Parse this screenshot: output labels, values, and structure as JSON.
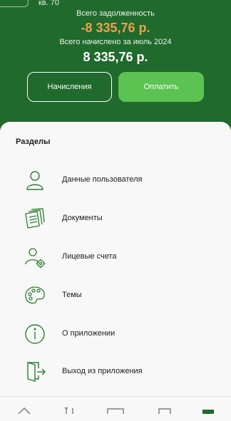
{
  "header": {
    "apartment": "кв. 70",
    "debt_label": "Всего задолженность",
    "debt_value": "-8 335,76 р.",
    "charged_label": "Всего начислено за июль 2024",
    "charged_value": "8 335,76 р."
  },
  "buttons": {
    "charges": "Начисления",
    "pay": "Оплатить"
  },
  "sections": {
    "title": "Разделы",
    "items": [
      {
        "label": "Данные пользователя",
        "icon": "user-icon"
      },
      {
        "label": "Документы",
        "icon": "documents-icon"
      },
      {
        "label": "Лицевые счета",
        "icon": "accounts-icon"
      },
      {
        "label": "Темы",
        "icon": "palette-icon"
      },
      {
        "label": "О приложении",
        "icon": "info-icon"
      },
      {
        "label": "Выход из приложения",
        "icon": "logout-icon"
      }
    ]
  },
  "colors": {
    "brand_green": "#1f6a2c",
    "accent_green": "#5cc251",
    "debt_orange": "#f0a050"
  }
}
